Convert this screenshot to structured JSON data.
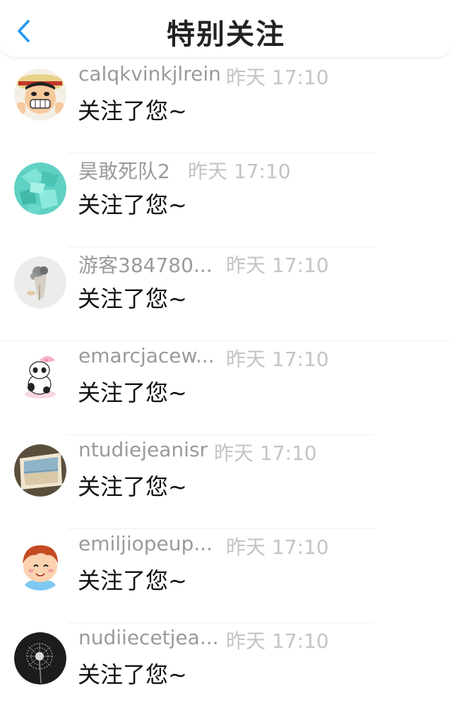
{
  "header": {
    "title": "特别关注",
    "back_icon": "chevron-left-icon",
    "accent": "#2196F3"
  },
  "items": [
    {
      "name": "calqkvinkjlrein",
      "time": "昨天 17:10",
      "message": "关注了您~",
      "avatar": "cartoon-pirate-avatar"
    },
    {
      "name": "昊敢死队2",
      "time": "昨天 17:10",
      "message": "关注了您~",
      "avatar": "teal-crystal-avatar"
    },
    {
      "name": "游客384780...",
      "time": "昨天 17:10",
      "message": "关注了您~",
      "avatar": "flower-bouquet-avatar"
    },
    {
      "name": "emarcjacew...",
      "time": "昨天 17:10",
      "message": "关注了您~",
      "avatar": "panda-cartoon-avatar"
    },
    {
      "name": "ntudiejeanisr",
      "time": "昨天 17:10",
      "message": "关注了您~",
      "avatar": "beach-photo-avatar"
    },
    {
      "name": "emiljiopeup...",
      "time": "昨天 17:10",
      "message": "关注了您~",
      "avatar": "cartoon-boy-avatar"
    },
    {
      "name": "nudiiecetjea...",
      "time": "昨天 17:10",
      "message": "关注了您~",
      "avatar": "dandelion-avatar"
    }
  ]
}
